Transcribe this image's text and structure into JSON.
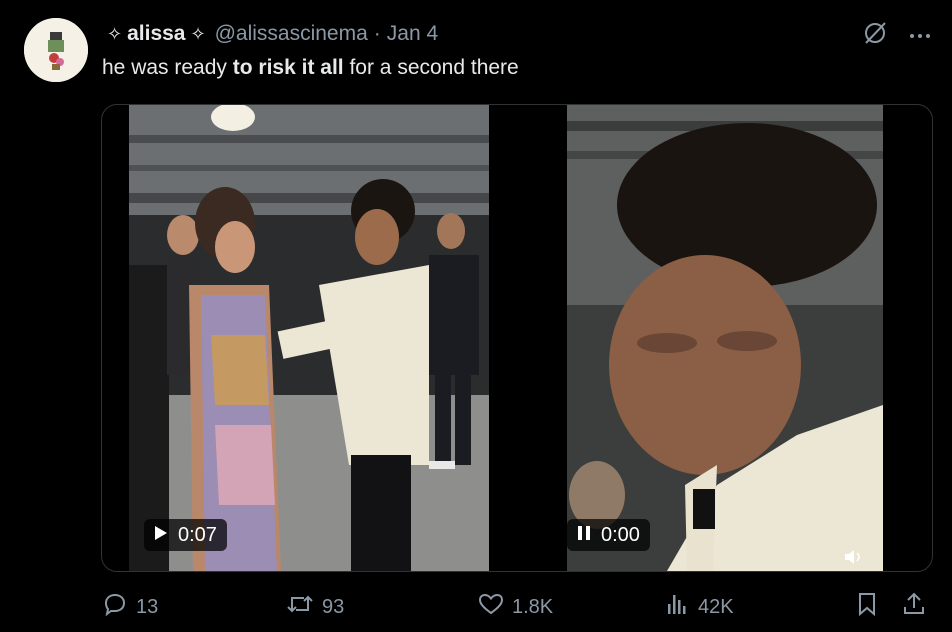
{
  "user": {
    "display_name": "alissa",
    "handle": "@alissascinema",
    "separator": "·",
    "date": "Jan 4"
  },
  "tweet": {
    "text_before": "he was ready ",
    "text_bold": "to risk it all",
    "text_after": " for a second there"
  },
  "media": {
    "video1": {
      "time": "0:07",
      "state": "play-icon"
    },
    "video2": {
      "time": "0:00",
      "state": "pause-icon"
    }
  },
  "actions": {
    "replies": "13",
    "retweets": "93",
    "likes": "1.8K",
    "views": "42K"
  },
  "icons": [
    "sparkle-icon",
    "grok-icon",
    "more-icon",
    "reply-icon",
    "retweet-icon",
    "like-icon",
    "views-icon",
    "bookmark-icon",
    "share-icon",
    "volume-icon"
  ],
  "colors": {
    "background": "#000000",
    "text": "#e7e9ea",
    "muted": "#8b98a5",
    "jacket": "#ece6d4"
  }
}
